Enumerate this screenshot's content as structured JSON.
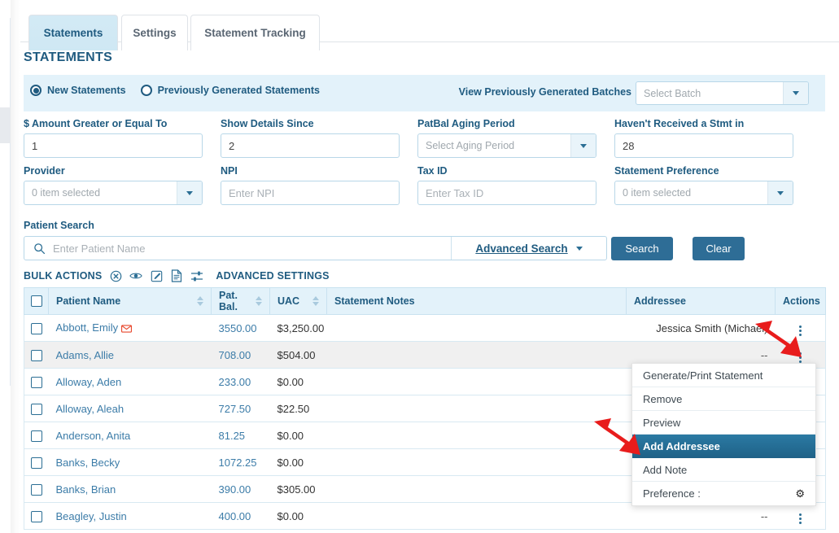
{
  "tabs": [
    {
      "label": "Statements",
      "active": true
    },
    {
      "label": "Settings",
      "active": false
    },
    {
      "label": "Statement Tracking",
      "active": false
    }
  ],
  "page_title": "STATEMENTS",
  "mode_panel": {
    "radio_new": "New Statements",
    "radio_previous": "Previously Generated Statements",
    "selected": "New Statements",
    "batches_label": "View Previously Generated Batches",
    "batch_select_placeholder": "Select Batch"
  },
  "filters": {
    "amount_label": "$ Amount Greater or Equal To",
    "amount_value": "1",
    "details_label": "Show Details Since",
    "details_value": "2",
    "aging_label": "PatBal Aging Period",
    "aging_placeholder": "Select Aging Period",
    "stmt_label": "Haven't Received a Stmt in",
    "stmt_value": "28",
    "provider_label": "Provider",
    "provider_value": "0 item selected",
    "npi_label": "NPI",
    "npi_placeholder": "Enter NPI",
    "taxid_label": "Tax ID",
    "taxid_placeholder": "Enter Tax ID",
    "pref_label": "Statement Preference",
    "pref_value": "0 item selected"
  },
  "patient_search": {
    "label": "Patient Search",
    "placeholder": "Enter Patient Name",
    "value": "",
    "advanced_search": "Advanced Search",
    "search_button": "Search",
    "clear_button": "Clear"
  },
  "bulk_actions": {
    "title": "BULK ACTIONS",
    "advanced_settings": "ADVANCED SETTINGS",
    "icons": [
      "remove-circle-icon",
      "eye-icon",
      "edit-note-icon",
      "document-icon",
      "sliders-icon"
    ]
  },
  "table": {
    "columns": [
      {
        "key": "checkbox",
        "label": "",
        "sortable": false
      },
      {
        "key": "patient_name",
        "label": "Patient Name",
        "sortable": true
      },
      {
        "key": "pat_bal",
        "label": "Pat. Bal.",
        "sortable": true
      },
      {
        "key": "uac",
        "label": "UAC",
        "sortable": true
      },
      {
        "key": "statement_notes",
        "label": "Statement Notes",
        "sortable": false
      },
      {
        "key": "addressee",
        "label": "Addressee",
        "sortable": false
      },
      {
        "key": "actions",
        "label": "Actions",
        "sortable": false
      }
    ],
    "rows": [
      {
        "name": "Abbott, Emily",
        "flag": true,
        "bal": "3550.00",
        "uac": "$3,250.00",
        "notes": "",
        "addressee": "Jessica Smith (Michael)"
      },
      {
        "name": "Adams, Allie",
        "flag": false,
        "bal": "708.00",
        "uac": "$504.00",
        "notes": "",
        "addressee": "--"
      },
      {
        "name": "Alloway, Aden",
        "flag": false,
        "bal": "233.00",
        "uac": "$0.00",
        "notes": "",
        "addressee": ""
      },
      {
        "name": "Alloway, Aleah",
        "flag": false,
        "bal": "727.50",
        "uac": "$22.50",
        "notes": "",
        "addressee": ""
      },
      {
        "name": "Anderson, Anita",
        "flag": false,
        "bal": "81.25",
        "uac": "$0.00",
        "notes": "",
        "addressee": ""
      },
      {
        "name": "Banks, Becky",
        "flag": false,
        "bal": "1072.25",
        "uac": "$0.00",
        "notes": "",
        "addressee": ""
      },
      {
        "name": "Banks, Brian",
        "flag": false,
        "bal": "390.00",
        "uac": "$305.00",
        "notes": "",
        "addressee": ""
      },
      {
        "name": "Beagley, Justin",
        "flag": false,
        "bal": "400.00",
        "uac": "$0.00",
        "notes": "",
        "addressee": "--"
      }
    ]
  },
  "context_menu": {
    "items": [
      {
        "label": "Generate/Print Statement",
        "selected": false,
        "gear": false
      },
      {
        "label": "Remove",
        "selected": false,
        "gear": false
      },
      {
        "label": "Preview",
        "selected": false,
        "gear": false
      },
      {
        "label": "Add Addressee",
        "selected": true,
        "gear": false
      },
      {
        "label": "Add Note",
        "selected": false,
        "gear": false
      },
      {
        "label": "Preference :",
        "selected": false,
        "gear": true
      }
    ]
  },
  "colors": {
    "brand_blue": "#1f5b80",
    "panel_blue": "#e3f2fa",
    "button_blue": "#2e6d96",
    "selected_menu": "#2b7aa3",
    "link_blue": "#3c7ca8",
    "arrow_red": "#e81c1c"
  }
}
